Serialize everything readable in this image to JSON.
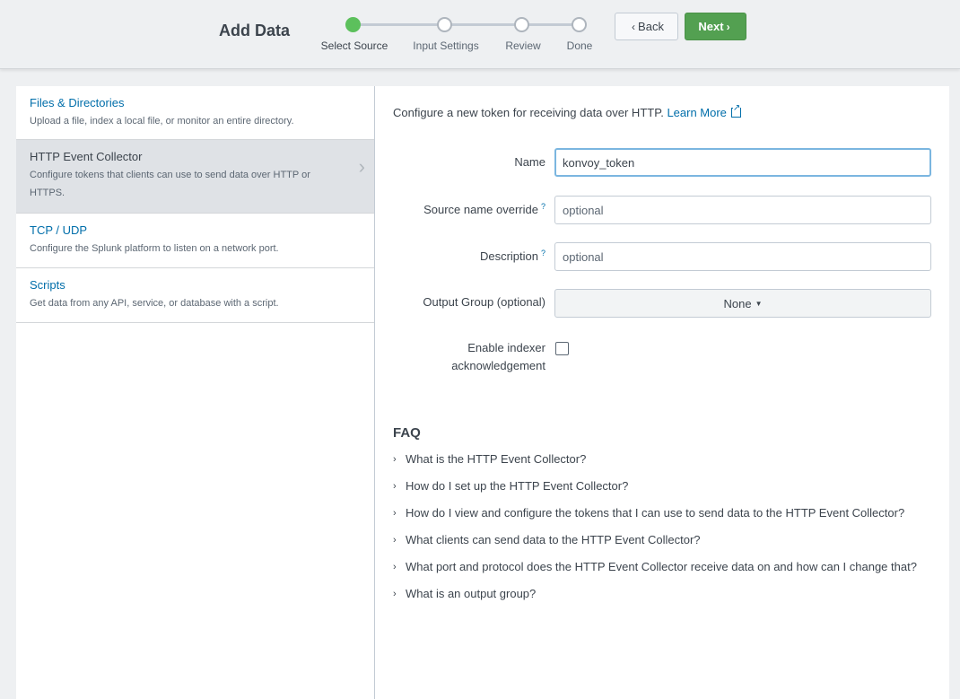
{
  "header": {
    "title": "Add Data",
    "steps": [
      "Select Source",
      "Input Settings",
      "Review",
      "Done"
    ],
    "active_step": 0,
    "back_label": "Back",
    "next_label": "Next"
  },
  "sidebar": {
    "items": [
      {
        "title": "Files & Directories",
        "desc": "Upload a file, index a local file, or monitor an entire directory."
      },
      {
        "title": "HTTP Event Collector",
        "desc": "Configure tokens that clients can use to send data over HTTP or HTTPS."
      },
      {
        "title": "TCP / UDP",
        "desc": "Configure the Splunk platform to listen on a network port."
      },
      {
        "title": "Scripts",
        "desc": "Get data from any API, service, or database with a script."
      }
    ],
    "selected_index": 1
  },
  "form": {
    "intro": "Configure a new token for receiving data over HTTP.",
    "learn_more": "Learn More",
    "name_label": "Name",
    "name_value": "konvoy_token",
    "source_label": "Source name override",
    "source_placeholder": "optional",
    "desc_label": "Description",
    "desc_placeholder": "optional",
    "help_mark": "?",
    "output_label": "Output Group (optional)",
    "output_value": "None",
    "ack_label": "Enable indexer acknowledgement",
    "ack_checked": false
  },
  "faq": {
    "title": "FAQ",
    "items": [
      "What is the HTTP Event Collector?",
      "How do I set up the HTTP Event Collector?",
      "How do I view and configure the tokens that I can use to send data to the HTTP Event Collector?",
      "What clients can send data to the HTTP Event Collector?",
      "What port and protocol does the HTTP Event Collector receive data on and how can I change that?",
      "What is an output group?"
    ]
  },
  "colors": {
    "accent": "#53a051",
    "link": "#006eaa",
    "selected_bg": "#dfe2e6"
  }
}
